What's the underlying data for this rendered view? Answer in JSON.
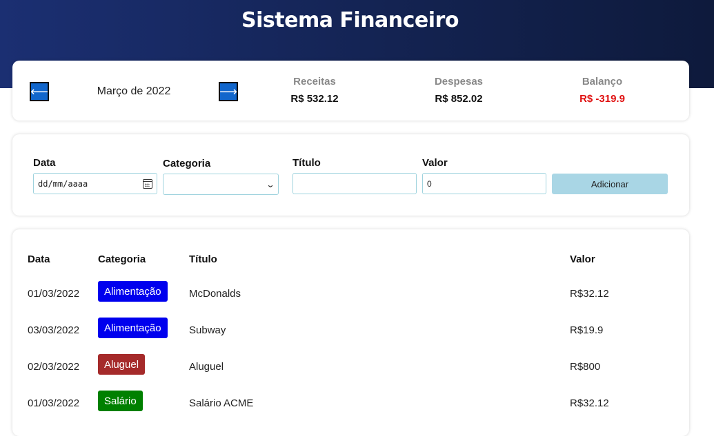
{
  "app": {
    "title": "Sistema Financeiro"
  },
  "info": {
    "prev_icon": "arrow-left-icon",
    "next_icon": "arrow-right-icon",
    "month": "Março de 2022",
    "receitas": {
      "label": "Receitas",
      "value": "R$ 532.12"
    },
    "despesas": {
      "label": "Despesas",
      "value": "R$ 852.02"
    },
    "balanco": {
      "label": "Balanço",
      "value": "R$ -319.9",
      "color": "#e01010"
    }
  },
  "form": {
    "data": {
      "label": "Data",
      "value": "dd/mm/aaaa"
    },
    "categoria": {
      "label": "Categoria",
      "value": ""
    },
    "titulo": {
      "label": "Título",
      "value": ""
    },
    "valor": {
      "label": "Valor",
      "value": "0"
    },
    "add_label": "Adicionar",
    "add_color": "#a9d6e5"
  },
  "table": {
    "headers": {
      "data": "Data",
      "categoria": "Categoria",
      "titulo": "Título",
      "valor": "Valor"
    },
    "rows": [
      {
        "data": "01/03/2022",
        "categoria": "Alimentação",
        "cat_color": "#0000ee",
        "titulo": "McDonalds",
        "valor": "R$32.12"
      },
      {
        "data": "03/03/2022",
        "categoria": "Alimentação",
        "cat_color": "#0000ee",
        "titulo": "Subway",
        "valor": "R$19.9"
      },
      {
        "data": "02/03/2022",
        "categoria": "Aluguel",
        "cat_color": "#a52a2a",
        "titulo": "Aluguel",
        "valor": "R$800"
      },
      {
        "data": "01/03/2022",
        "categoria": "Salário",
        "cat_color": "#008000",
        "titulo": "Salário ACME",
        "valor": "R$32.12"
      }
    ]
  }
}
